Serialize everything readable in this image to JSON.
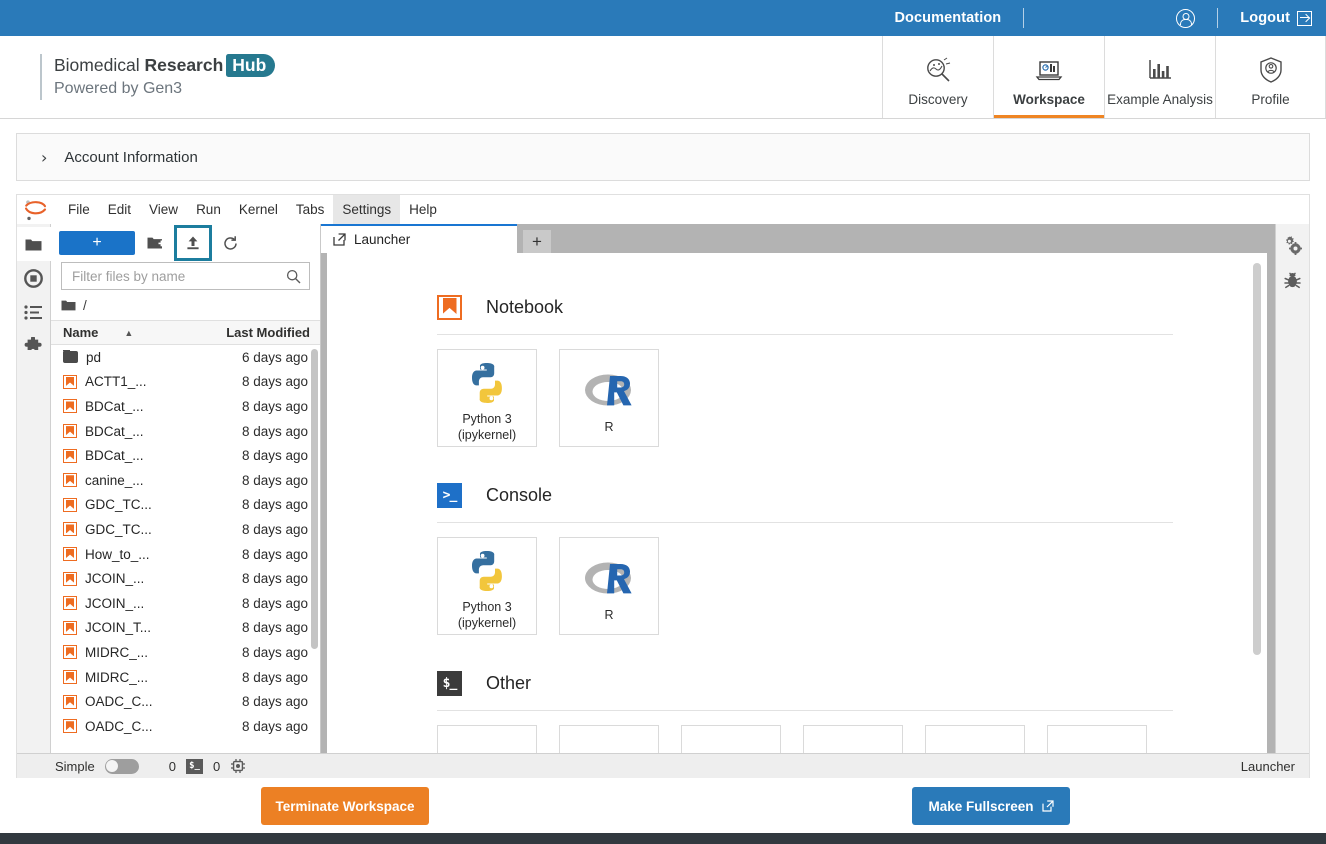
{
  "topbar": {
    "documentation_label": "Documentation",
    "user_icon": "user-circle-icon",
    "logout_label": "Logout",
    "logout_icon": "logout-arrow-icon",
    "background_color": "#2a7ab9"
  },
  "header": {
    "logo_pre": "Biomedical",
    "logo_bold": "Research",
    "logo_badge": "Hub",
    "logo_badge_color": "#26798f",
    "logo_sub": "Powered by Gen3",
    "nav": [
      {
        "label": "Discovery",
        "icon": "magnifier-discovery-icon",
        "active": false
      },
      {
        "label": "Workspace",
        "icon": "laptop-workspace-icon",
        "active": true
      },
      {
        "label": "Example Analysis",
        "icon": "bar-chart-icon",
        "active": false
      },
      {
        "label": "Profile",
        "icon": "shield-user-icon",
        "active": false
      }
    ],
    "active_underline_color": "#ef8523"
  },
  "account_panel": {
    "chevron": "›",
    "label": "Account Information"
  },
  "jupyter": {
    "logo_icon": "jupyter-logo-icon",
    "menus": [
      {
        "label": "File",
        "highlighted": false
      },
      {
        "label": "Edit",
        "highlighted": false
      },
      {
        "label": "View",
        "highlighted": false
      },
      {
        "label": "Run",
        "highlighted": false
      },
      {
        "label": "Kernel",
        "highlighted": false
      },
      {
        "label": "Tabs",
        "highlighted": false
      },
      {
        "label": "Settings",
        "highlighted": true
      },
      {
        "label": "Help",
        "highlighted": false
      }
    ],
    "left_rail": [
      {
        "name": "file-browser-icon",
        "active": true
      },
      {
        "name": "running-sessions-icon",
        "active": false
      },
      {
        "name": "commands-list-icon",
        "active": false
      },
      {
        "name": "extensions-puzzle-icon",
        "active": false
      }
    ],
    "right_rail": [
      {
        "name": "property-inspector-gears-icon"
      },
      {
        "name": "debugger-bug-icon"
      }
    ],
    "filebrowser": {
      "new_button_label": "+",
      "new_folder_icon": "new-folder-icon",
      "upload_icon": "upload-icon",
      "upload_highlighted": true,
      "upload_highlight_color": "#1c7d9e",
      "refresh_icon": "refresh-icon",
      "filter_placeholder": "Filter files by name",
      "filter_value": "",
      "search_icon": "search-icon",
      "breadcrumb_root": "/",
      "breadcrumb_icon": "folder-icon",
      "columns": [
        "Name",
        "Last Modified"
      ],
      "sort_caret": "▲",
      "rows": [
        {
          "icon": "folder-icon",
          "name": "pd",
          "modified": "6 days ago"
        },
        {
          "icon": "notebook-icon",
          "name": "ACTT1_...",
          "modified": "8 days ago"
        },
        {
          "icon": "notebook-icon",
          "name": "BDCat_...",
          "modified": "8 days ago"
        },
        {
          "icon": "notebook-icon",
          "name": "BDCat_...",
          "modified": "8 days ago"
        },
        {
          "icon": "notebook-icon",
          "name": "BDCat_...",
          "modified": "8 days ago"
        },
        {
          "icon": "notebook-icon",
          "name": "canine_...",
          "modified": "8 days ago"
        },
        {
          "icon": "notebook-icon",
          "name": "GDC_TC...",
          "modified": "8 days ago"
        },
        {
          "icon": "notebook-icon",
          "name": "GDC_TC...",
          "modified": "8 days ago"
        },
        {
          "icon": "notebook-icon",
          "name": "How_to_...",
          "modified": "8 days ago"
        },
        {
          "icon": "notebook-icon",
          "name": "JCOIN_...",
          "modified": "8 days ago"
        },
        {
          "icon": "notebook-icon",
          "name": "JCOIN_...",
          "modified": "8 days ago"
        },
        {
          "icon": "notebook-icon",
          "name": "JCOIN_T...",
          "modified": "8 days ago"
        },
        {
          "icon": "notebook-icon",
          "name": "MIDRC_...",
          "modified": "8 days ago"
        },
        {
          "icon": "notebook-icon",
          "name": "MIDRC_...",
          "modified": "8 days ago"
        },
        {
          "icon": "notebook-icon",
          "name": "OADC_C...",
          "modified": "8 days ago"
        },
        {
          "icon": "notebook-icon",
          "name": "OADC_C...",
          "modified": "8 days ago"
        }
      ]
    },
    "dock": {
      "tabs": [
        {
          "label": "Launcher",
          "icon": "launcher-tab-icon",
          "active": true
        }
      ],
      "add_tab_label": "+",
      "launcher": {
        "sections": [
          {
            "title": "Notebook",
            "icon": "notebook-section-icon",
            "cards": [
              {
                "label": "Python 3\n(ipykernel)",
                "label_line1": "Python 3",
                "label_line2": "(ipykernel)",
                "icon": "python-logo-icon"
              },
              {
                "label": "R",
                "label_line1": "R",
                "label_line2": "",
                "icon": "r-logo-icon"
              }
            ]
          },
          {
            "title": "Console",
            "icon": "console-section-icon",
            "icon_glyph": ">_",
            "cards": [
              {
                "label": "Python 3\n(ipykernel)",
                "label_line1": "Python 3",
                "label_line2": "(ipykernel)",
                "icon": "python-logo-icon"
              },
              {
                "label": "R",
                "label_line1": "R",
                "label_line2": "",
                "icon": "r-logo-icon"
              }
            ]
          },
          {
            "title": "Other",
            "icon": "other-section-icon",
            "icon_glyph": "$_",
            "cards": [
              {
                "label": "",
                "icon": "terminal-icon"
              },
              {
                "label": "",
                "icon": "text-file-icon"
              },
              {
                "label": "",
                "icon": "markdown-icon"
              },
              {
                "label": "",
                "icon": "python-file-icon"
              },
              {
                "label": "",
                "icon": "r-file-icon"
              },
              {
                "label": "",
                "icon": "contextual-help-icon"
              }
            ]
          }
        ]
      }
    },
    "statusbar": {
      "mode_label": "Simple",
      "mode_enabled": false,
      "kernel_count": "0",
      "terminal_icon": "terminal-icon",
      "terminal_count": "0",
      "resource_icon": "cpu-chip-icon",
      "right_label": "Launcher"
    }
  },
  "footer": {
    "terminate_label": "Terminate Workspace",
    "terminate_color": "#ec8024",
    "fullscreen_label": "Make Fullscreen",
    "fullscreen_icon": "external-link-icon",
    "fullscreen_color": "#2a7ab9"
  }
}
